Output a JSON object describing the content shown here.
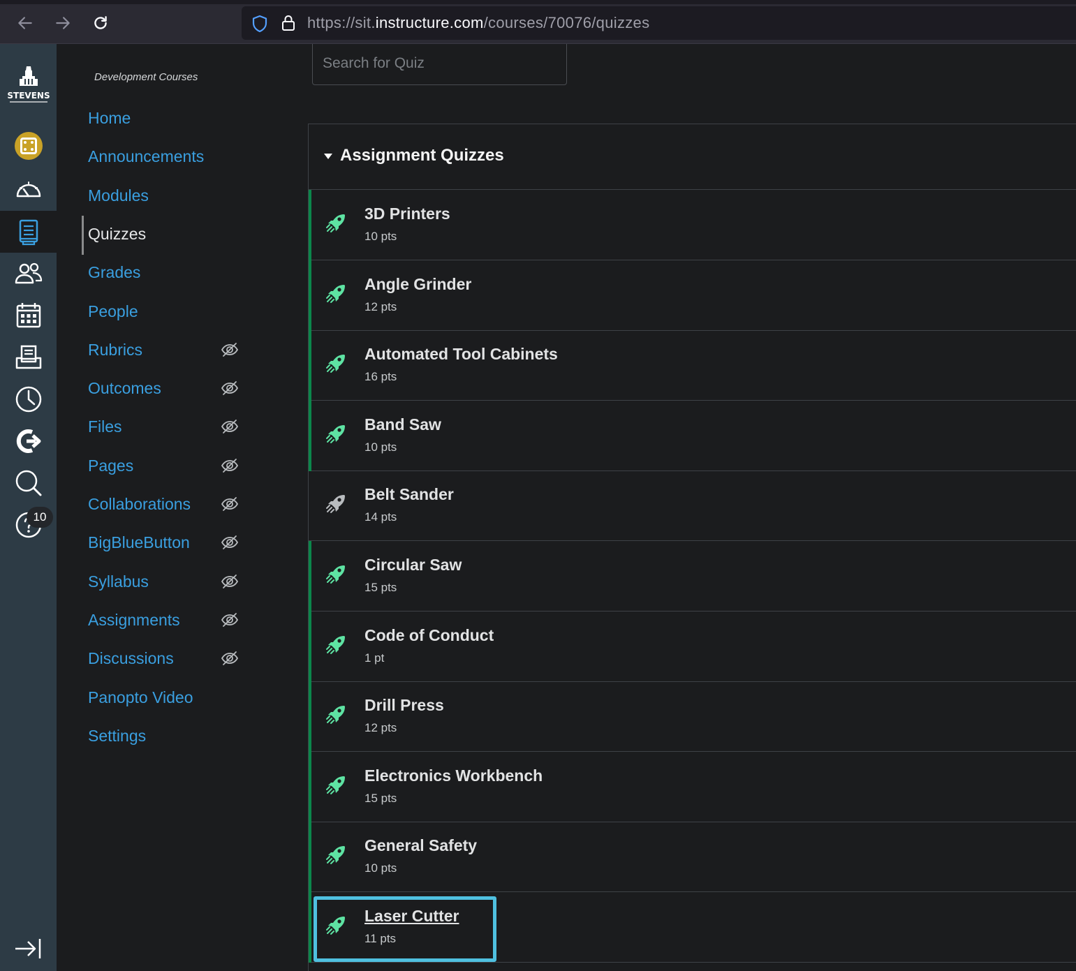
{
  "browser": {
    "url_prefix": "https://sit.",
    "url_domain": "instructure.com",
    "url_path": "/courses/70076/quizzes"
  },
  "global_nav": {
    "logo_text": "STEVENS",
    "help_badge": "10"
  },
  "course_nav": {
    "course_title": "Development Courses",
    "items": [
      {
        "label": "Home",
        "hidden": false,
        "active": false
      },
      {
        "label": "Announcements",
        "hidden": false,
        "active": false
      },
      {
        "label": "Modules",
        "hidden": false,
        "active": false
      },
      {
        "label": "Quizzes",
        "hidden": false,
        "active": true
      },
      {
        "label": "Grades",
        "hidden": false,
        "active": false
      },
      {
        "label": "People",
        "hidden": false,
        "active": false
      },
      {
        "label": "Rubrics",
        "hidden": true,
        "active": false
      },
      {
        "label": "Outcomes",
        "hidden": true,
        "active": false
      },
      {
        "label": "Files",
        "hidden": true,
        "active": false
      },
      {
        "label": "Pages",
        "hidden": true,
        "active": false
      },
      {
        "label": "Collaborations",
        "hidden": true,
        "active": false
      },
      {
        "label": "BigBlueButton",
        "hidden": true,
        "active": false
      },
      {
        "label": "Syllabus",
        "hidden": true,
        "active": false
      },
      {
        "label": "Assignments",
        "hidden": true,
        "active": false
      },
      {
        "label": "Discussions",
        "hidden": true,
        "active": false
      },
      {
        "label": "Panopto Video",
        "hidden": false,
        "active": false
      },
      {
        "label": "Settings",
        "hidden": false,
        "active": false
      }
    ]
  },
  "main": {
    "search_placeholder": "Search for Quiz",
    "group_title": "Assignment Quizzes",
    "quizzes": [
      {
        "name": "3D Printers",
        "points": "10 pts",
        "published": true
      },
      {
        "name": "Angle Grinder",
        "points": "12 pts",
        "published": true
      },
      {
        "name": "Automated Tool Cabinets",
        "points": "16 pts",
        "published": true
      },
      {
        "name": "Band Saw",
        "points": "10 pts",
        "published": true
      },
      {
        "name": "Belt Sander",
        "points": "14 pts",
        "published": false
      },
      {
        "name": "Circular Saw",
        "points": "15 pts",
        "published": true
      },
      {
        "name": "Code of Conduct",
        "points": "1 pt",
        "published": true
      },
      {
        "name": "Drill Press",
        "points": "12 pts",
        "published": true
      },
      {
        "name": "Electronics Workbench",
        "points": "15 pts",
        "published": true
      },
      {
        "name": "General Safety",
        "points": "10 pts",
        "published": true
      },
      {
        "name": "Laser Cutter",
        "points": "11 pts",
        "published": true
      }
    ]
  },
  "colors": {
    "link": "#3a9fe0",
    "published": "#0b874b",
    "published_icon": "#5ee3a3",
    "unpublished_icon": "#b9bcbf",
    "focus_ring": "#4fc0e0",
    "global_nav_bg": "#2d3b45"
  }
}
